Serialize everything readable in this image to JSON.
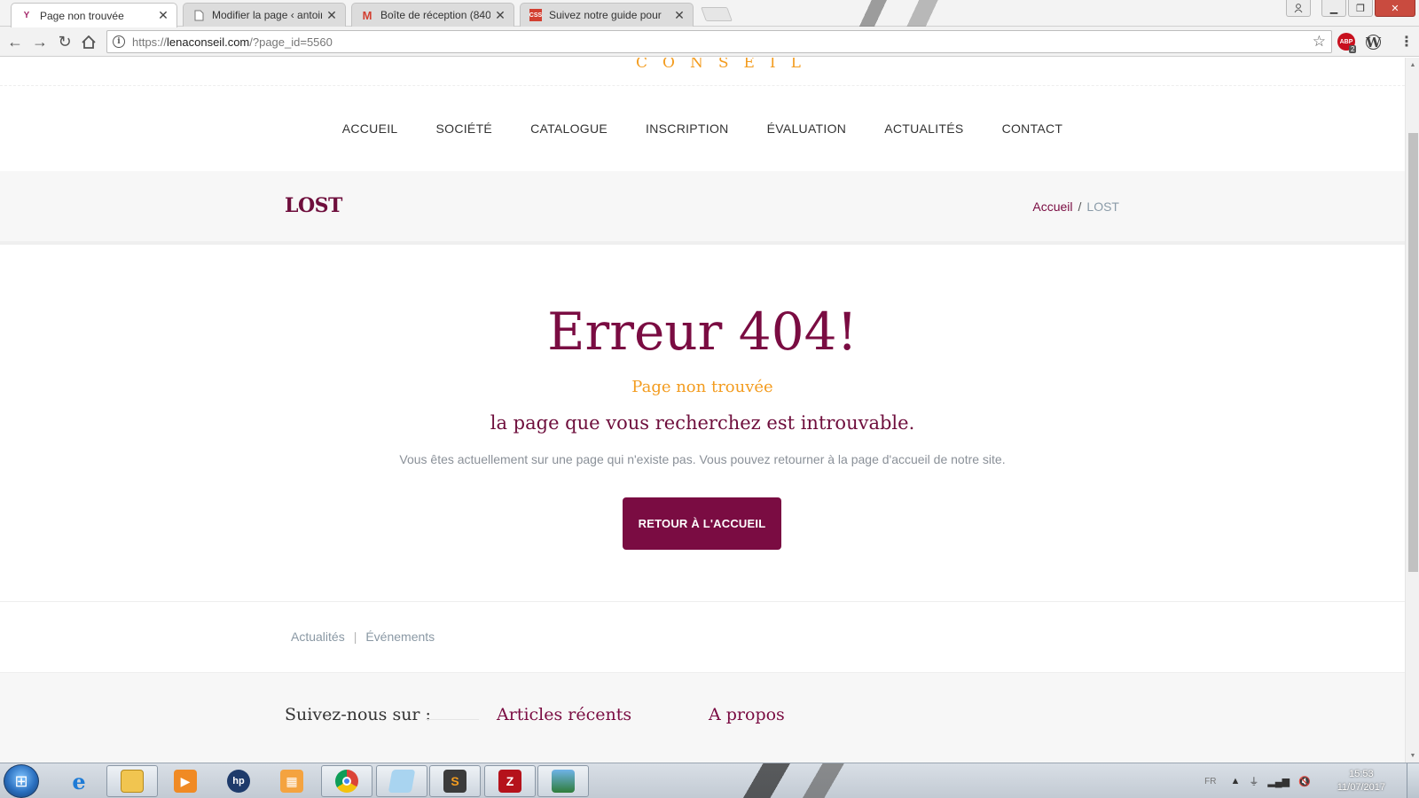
{
  "browser": {
    "tabs": [
      {
        "label": "Page non trouvée",
        "icon": "yoast-icon",
        "active": true
      },
      {
        "label": "Modifier la page ‹ antoin",
        "icon": "page-icon",
        "active": false
      },
      {
        "label": "Boîte de réception (840)",
        "icon": "gmail-icon",
        "active": false
      },
      {
        "label": "Suivez notre guide pour",
        "icon": "css-icon",
        "active": false
      }
    ],
    "url_prefix": "https://",
    "url_domain": "lenaconseil.com",
    "url_rest": "/?page_id=5560",
    "abp_badge": "2",
    "abp_label": "ABP"
  },
  "site": {
    "logo_text": "CONSEIL",
    "nav": [
      "ACCUEIL",
      "SOCIÉTÉ",
      "CATALOGUE",
      "INSCRIPTION",
      "ÉVALUATION",
      "ACTUALITÉS",
      "CONTACT"
    ],
    "page_title": "LOST",
    "breadcrumb": {
      "home": "Accueil",
      "separator": "/",
      "current": "LOST"
    },
    "error": {
      "heading": "Erreur 404!",
      "subtitle": "Page non trouvée",
      "message": "la page que vous recherchez est introuvable.",
      "description": "Vous êtes actuellement sur une page qui n'existe pas. Vous pouvez retourner à la page d'accueil de notre site.",
      "button": "RETOUR À L'ACCUEIL"
    },
    "footer_links": [
      "Actualités",
      "Événements"
    ],
    "footer_columns": [
      "Suivez-nous sur :",
      "Articles récents",
      "A propos"
    ]
  },
  "taskbar": {
    "language": "FR",
    "time": "15:53",
    "date": "11/07/2017"
  },
  "colors": {
    "brand": "#7a0c42",
    "accent": "#f39c1f"
  }
}
